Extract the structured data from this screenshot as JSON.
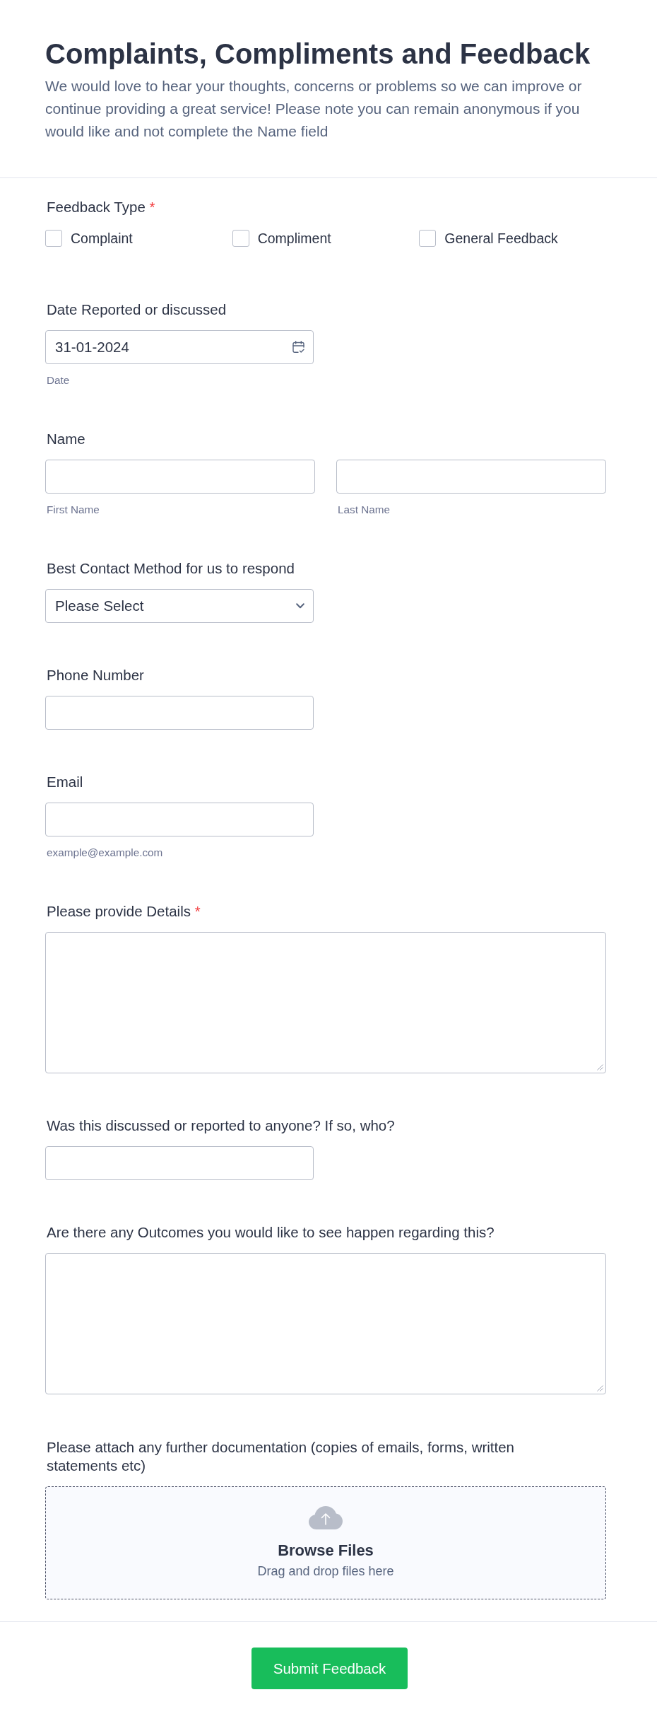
{
  "header": {
    "title": "Complaints, Compliments and Feedback",
    "description": "We would love to hear your thoughts, concerns or problems so we can improve or continue providing a great service! Please note you can remain anonymous if you would like and not complete the Name field"
  },
  "fields": [
    {
      "kind": "checkboxes",
      "label": "Feedback Type",
      "required_mark": "*",
      "options": [
        {
          "label": "Complaint",
          "checked": false
        },
        {
          "label": "Compliment",
          "checked": false
        },
        {
          "label": "General Feedback",
          "checked": false
        }
      ]
    },
    {
      "kind": "date",
      "label": "Date Reported or discussed",
      "value": "31-01-2024",
      "sublabel": "Date"
    },
    {
      "kind": "fullname",
      "label": "Name",
      "inputs": [
        {
          "sublabel": "First Name"
        },
        {
          "sublabel": "Last Name"
        }
      ]
    },
    {
      "kind": "select",
      "label": "Best Contact Method for us to respond",
      "value": "Please Select"
    },
    {
      "kind": "text",
      "label": "Phone Number"
    },
    {
      "kind": "text",
      "label": "Email",
      "sublabel": "example@example.com"
    },
    {
      "kind": "textarea",
      "label": "Please provide Details",
      "required_mark": "*"
    },
    {
      "kind": "text",
      "label": "Was this discussed or reported to anyone? If so, who?"
    },
    {
      "kind": "textarea",
      "label": "Are there any Outcomes you would like to see happen regarding this?"
    },
    {
      "kind": "upload",
      "label": "Please attach any further documentation (copies of emails, forms, written statements etc)",
      "button": "Browse Files",
      "hint": "Drag and drop files here"
    }
  ],
  "submit": {
    "label": "Submit Feedback"
  }
}
